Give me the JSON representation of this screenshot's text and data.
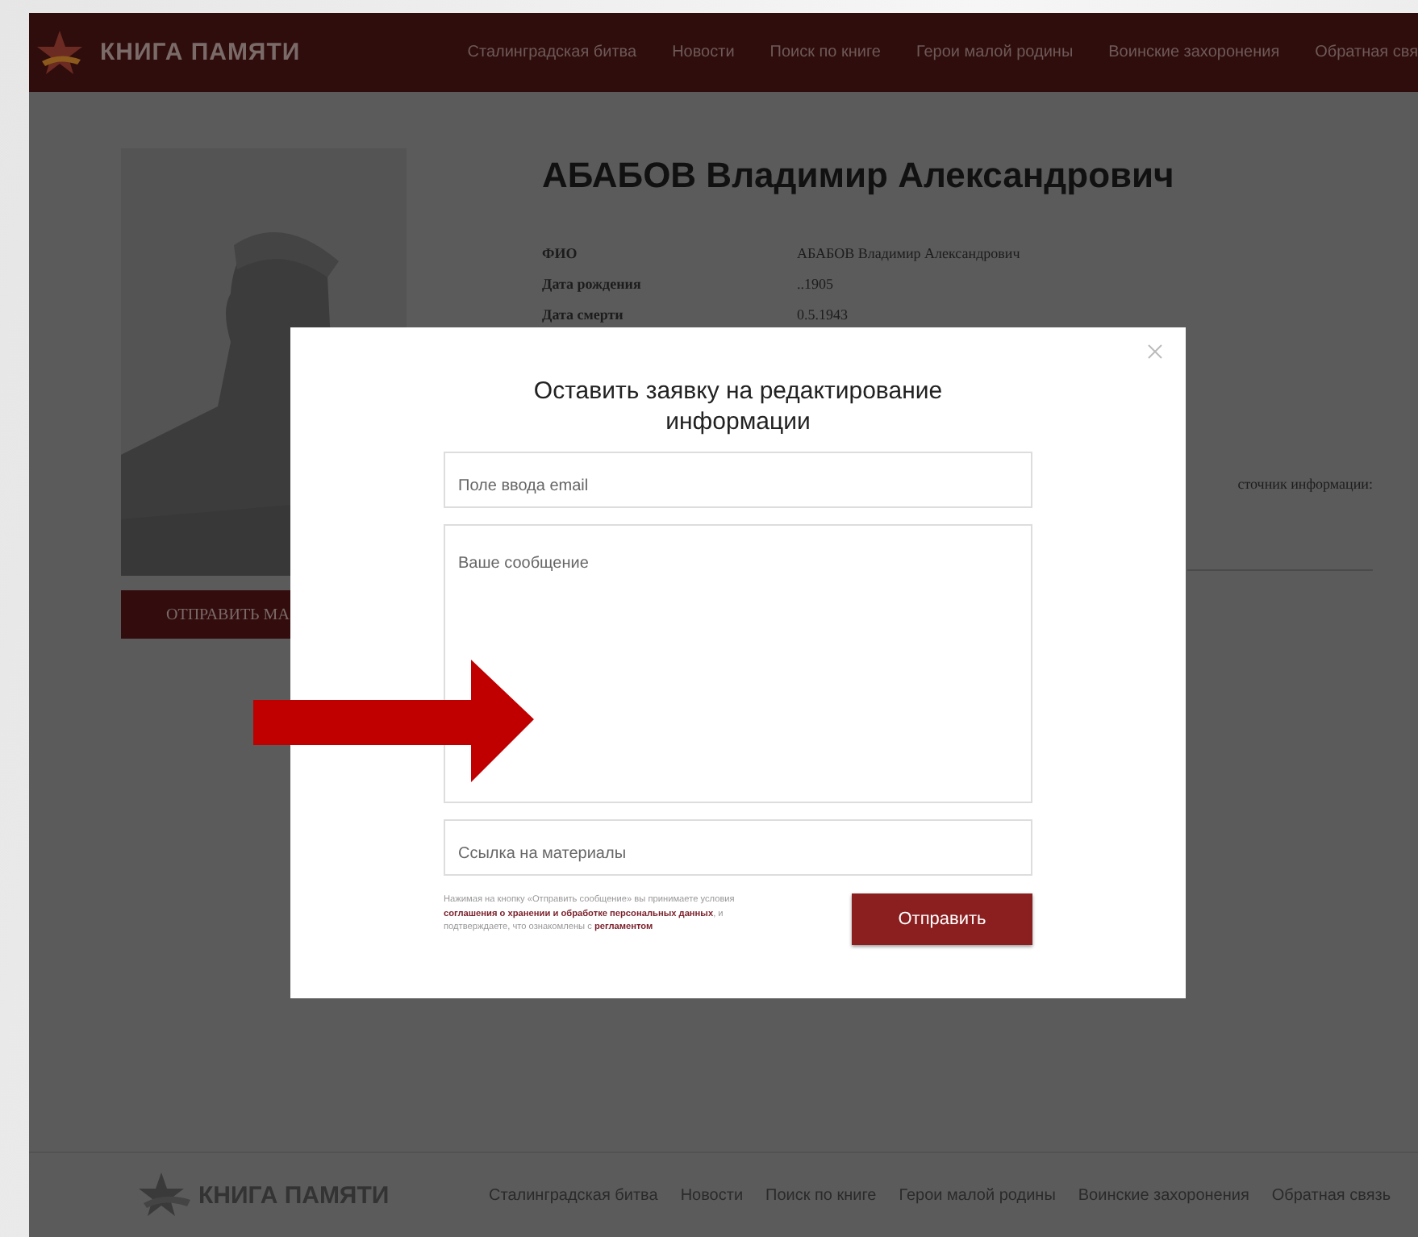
{
  "header": {
    "logo": "КНИГА ПАМЯТИ",
    "nav": [
      "Сталинградская битва",
      "Новости",
      "Поиск по книге",
      "Герои малой родины",
      "Воинские захоронения",
      "Обратная свя"
    ]
  },
  "profile": {
    "button": "ОТПРАВИТЬ МА",
    "title": "АБАБОВ Владимир Александрович",
    "fields": [
      {
        "label": "ФИО",
        "value": "АБАБОВ Владимир Александрович"
      },
      {
        "label": "Дата рождения",
        "value": "..1905"
      },
      {
        "label": "Дата смерти",
        "value": "0.5.1943"
      }
    ],
    "source_fragment": "сточник информации:"
  },
  "modal": {
    "title": "Оставить заявку на редактирование информации",
    "fields": [
      {
        "kind": "input",
        "placeholder": "Поле ввода email"
      },
      {
        "kind": "textarea",
        "placeholder": "Ваше сообщение"
      },
      {
        "kind": "input",
        "placeholder": "Ссылка на материалы"
      }
    ],
    "consent": "Нажимая на кнопку «Отправить сообщение» вы принимаете условия **соглашения о хранении и обработке персональных данных**, и подтверждаете, что ознакомлены с **регламентом**",
    "submit": "Отправить"
  },
  "footer": {
    "logo": "КНИГА ПАМЯТИ",
    "nav": [
      "Сталинградская битва",
      "Новости",
      "Поиск по книге",
      "Герои малой родины",
      "Воинские захоронения",
      "Обратная связь"
    ]
  }
}
